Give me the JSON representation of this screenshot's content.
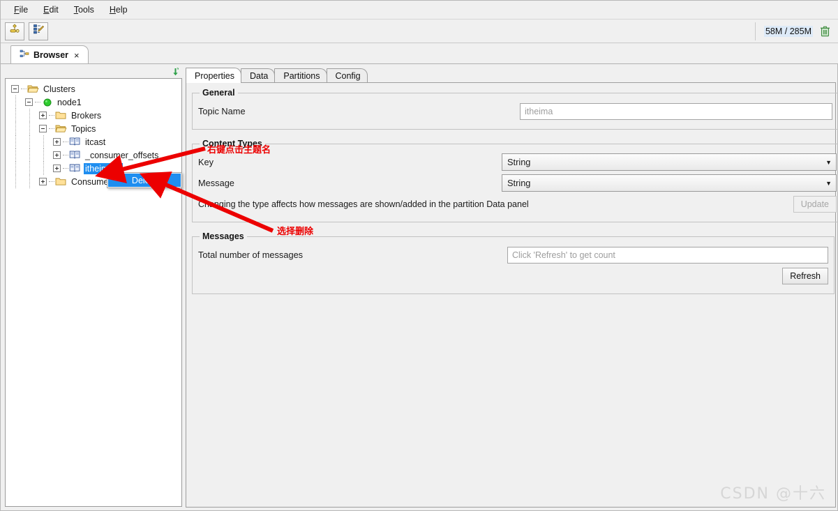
{
  "window": {
    "menubar": [
      {
        "label": "File",
        "mnemonic": "F"
      },
      {
        "label": "Edit",
        "mnemonic": "E"
      },
      {
        "label": "Tools",
        "mnemonic": "T"
      },
      {
        "label": "Help",
        "mnemonic": "H"
      }
    ],
    "toolbar": {
      "buttons": [
        {
          "name": "add-cluster-icon",
          "title": "Add Cluster"
        },
        {
          "name": "edit-tree-icon",
          "title": "Edit"
        }
      ],
      "memory_text": "58M / 285M",
      "trash_icon": "trash-icon"
    },
    "view_tabs": [
      {
        "label": "Browser",
        "icon": "tree-icon",
        "close": "×",
        "active": true
      }
    ]
  },
  "tree": {
    "collapse_icon": "collapse-all-icon",
    "nodes": [
      {
        "label": "Clusters",
        "depth": 0,
        "icon": "folder-open-icon",
        "twist": "minus",
        "selected": false
      },
      {
        "label": "node1",
        "depth": 1,
        "icon": "status-online-icon",
        "twist": "minus",
        "selected": false
      },
      {
        "label": "Brokers",
        "depth": 2,
        "icon": "folder-closed-icon",
        "twist": "plus",
        "selected": false
      },
      {
        "label": "Topics",
        "depth": 2,
        "icon": "folder-open-icon",
        "twist": "minus",
        "selected": false
      },
      {
        "label": "itcast",
        "depth": 3,
        "icon": "topic-icon",
        "twist": "plus",
        "selected": false
      },
      {
        "label": "_consumer_offsets",
        "depth": 3,
        "icon": "topic-icon",
        "twist": "plus",
        "selected": false
      },
      {
        "label": "itheima",
        "depth": 3,
        "icon": "topic-icon",
        "twist": "plus",
        "selected": true
      },
      {
        "label": "Consumers",
        "depth": 2,
        "icon": "folder-closed-icon",
        "twist": "plus",
        "selected": false
      }
    ]
  },
  "context_menu": {
    "items": [
      {
        "label": "Delete",
        "highlighted": true
      }
    ]
  },
  "properties": {
    "tabs": [
      {
        "label": "Properties",
        "active": true
      },
      {
        "label": "Data",
        "active": false
      },
      {
        "label": "Partitions",
        "active": false
      },
      {
        "label": "Config",
        "active": false
      }
    ],
    "general": {
      "legend": "General",
      "topic_name_label": "Topic Name",
      "topic_name_value": "itheima",
      "topic_name_placeholder": "itheima"
    },
    "content_types": {
      "legend": "Content Types",
      "key_label": "Key",
      "key_value": "String",
      "message_label": "Message",
      "message_value": "String",
      "hint": "Changing the type affects how messages are shown/added in the partition Data panel",
      "update_button": "Update",
      "update_disabled": true,
      "dropdown_arrow": "▼"
    },
    "messages": {
      "legend": "Messages",
      "total_label": "Total number of messages",
      "total_placeholder": "Click 'Refresh' to get count",
      "refresh_button": "Refresh"
    }
  },
  "annotations": [
    {
      "id": "anno-1",
      "text": "右键点击主题名",
      "color": "#ec0000"
    },
    {
      "id": "anno-2",
      "text": "选择删除",
      "color": "#ec0000"
    }
  ],
  "watermark": "CSDN @十六",
  "colors": {
    "selection_blue": "#1f8ef0",
    "annotation_red": "#ec0000",
    "online_green": "#22c522",
    "panel_bg": "#f0f0f0"
  }
}
